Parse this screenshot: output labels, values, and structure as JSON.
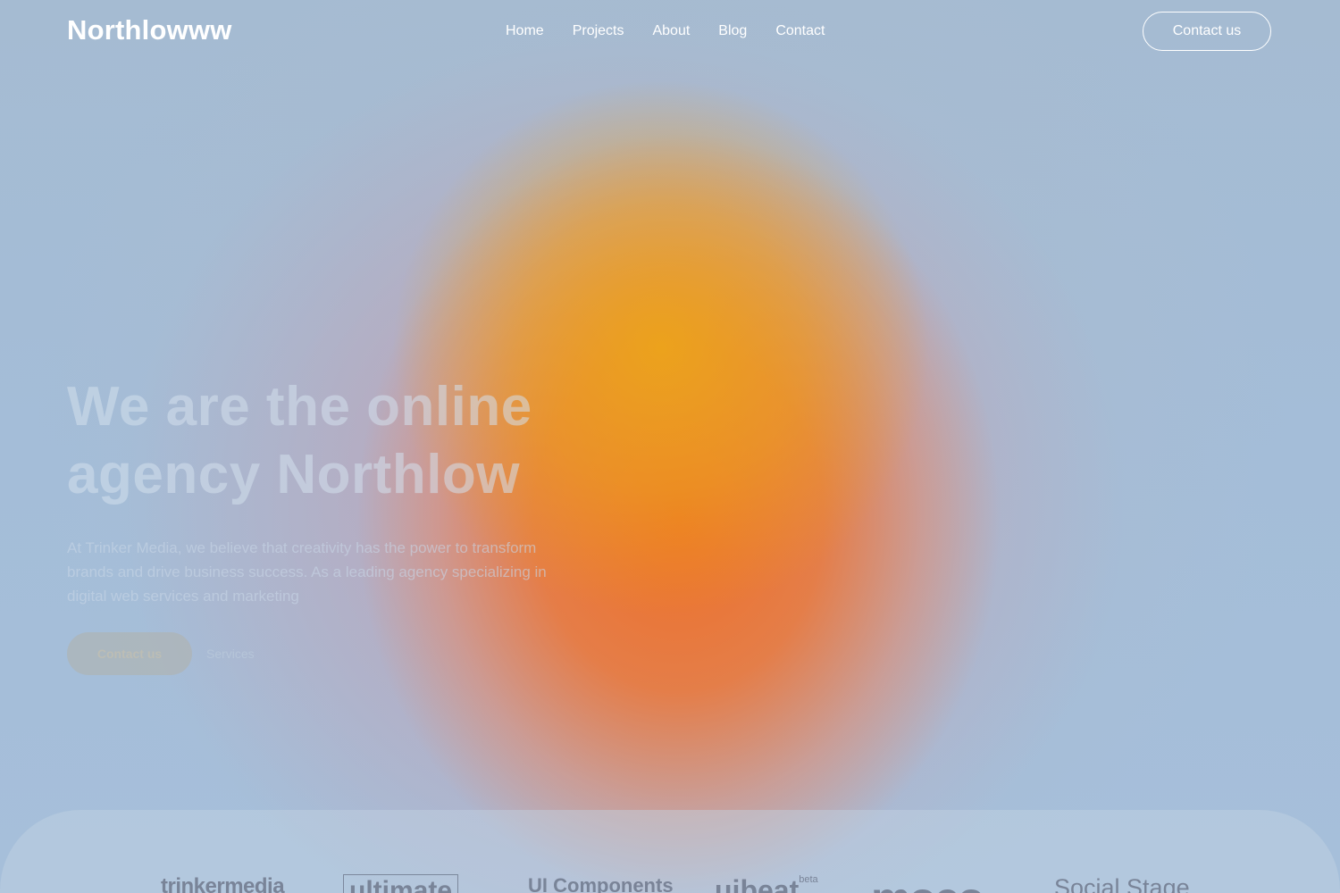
{
  "header": {
    "logo": "Northlowww",
    "nav": [
      "Home",
      "Projects",
      "About",
      "Blog",
      "Contact"
    ],
    "cta_label": "Contact us"
  },
  "hero": {
    "title_line1": "We are the online",
    "title_line2": "agency Northlow",
    "description": "At Trinker Media, we believe that creativity has the power to transform brands and drive business success. As a leading agency specializing in digital web services and marketing",
    "primary_button": "Contact us",
    "secondary_link": "Services"
  },
  "partners": {
    "logos": [
      "trinkermedia",
      "ultimate",
      "UI Components",
      "ujbeat",
      "moco",
      "Social Stage"
    ],
    "beta_tag": "beta"
  },
  "colors": {
    "background": "#a6bcd6",
    "orb_core": "#ee7028",
    "orb_top": "#eca41a",
    "header_text": "#ffffff"
  }
}
